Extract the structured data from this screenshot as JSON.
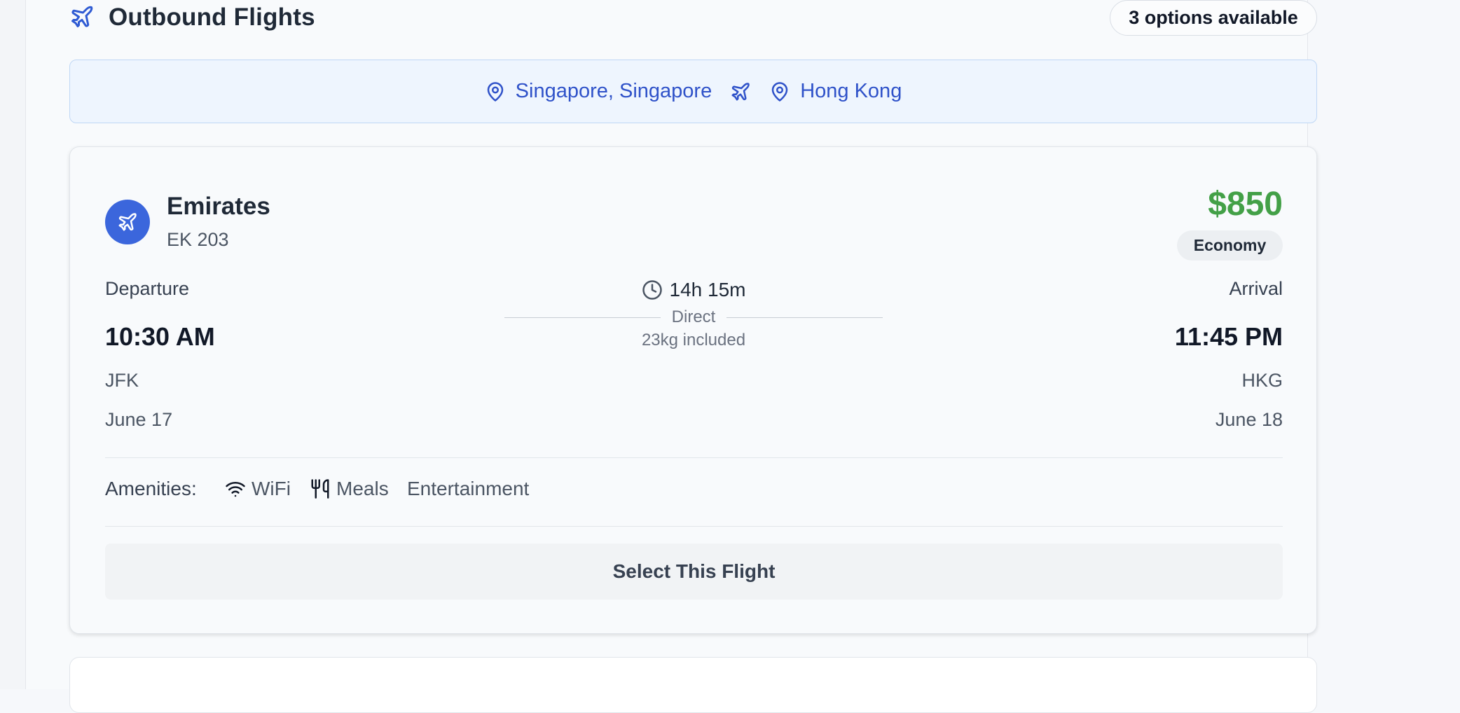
{
  "header": {
    "icon": "plane-icon",
    "title": "Outbound Flights",
    "options_badge": "3 options available"
  },
  "route": {
    "origin": "Singapore, Singapore",
    "destination": "Hong Kong",
    "origin_icon": "map-pin-icon",
    "separator_icon": "plane-icon",
    "destination_icon": "map-pin-icon",
    "accent_color": "#2f52c9"
  },
  "flight": {
    "airline": "Emirates",
    "flight_number": "EK 203",
    "price": "$850",
    "cabin_class": "Economy",
    "price_color": "#43a047",
    "departure": {
      "label": "Departure",
      "time": "10:30 AM",
      "airport": "JFK",
      "date": "June 17"
    },
    "arrival": {
      "label": "Arrival",
      "time": "11:45 PM",
      "airport": "HKG",
      "date": "June 18"
    },
    "duration": "14h 15m",
    "stops": "Direct",
    "baggage": "23kg included",
    "amenities_label": "Amenities:",
    "amenities": [
      {
        "icon": "wifi-icon",
        "label": "WiFi"
      },
      {
        "icon": "utensils-icon",
        "label": "Meals"
      },
      {
        "icon": "",
        "label": "Entertainment"
      }
    ],
    "select_label": "Select This Flight"
  }
}
